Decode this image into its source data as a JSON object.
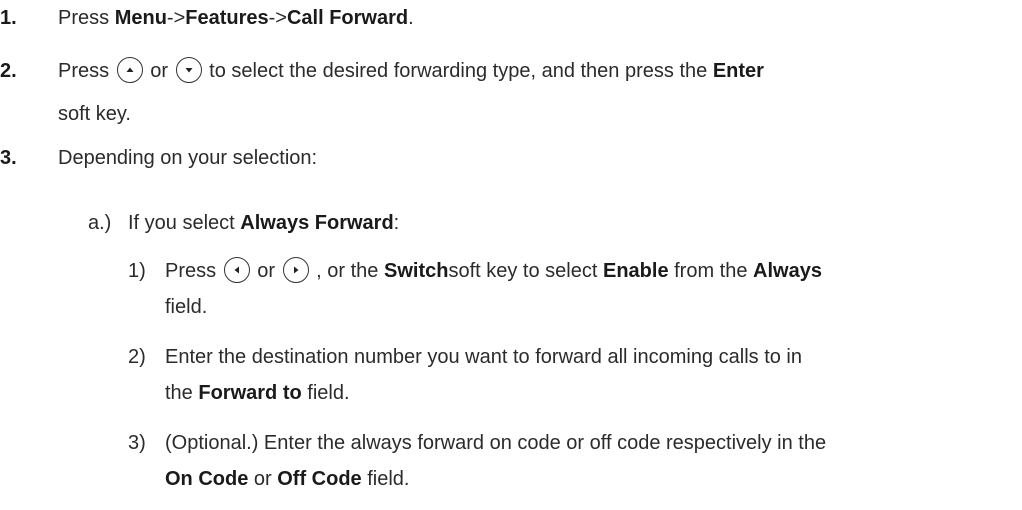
{
  "steps": [
    {
      "number": "1.",
      "text1": "Press ",
      "menu": "Menu",
      "sep1": "->",
      "features": "Features",
      "sep2": "->",
      "call_forward": "Call Forward",
      "end": "."
    },
    {
      "number": "2.",
      "text1": "Press",
      "or": "or",
      "text2": "to select the desired forwarding type, and then press the",
      "enter": "Enter",
      "text3": "soft key."
    },
    {
      "number": "3.",
      "text": "Depending on your selection:"
    }
  ],
  "substep_a": {
    "label": "a.)",
    "text1": "If you select ",
    "always_forward": "Always Forward",
    "end": ":"
  },
  "items": [
    {
      "label": "1)",
      "text1": "Press",
      "or": "or",
      "text2": ", or the",
      "switch": "Switch",
      "text3": "soft key to select",
      "enable": "Enable",
      "text4": "from the",
      "always": "Always",
      "text5": "field."
    },
    {
      "label": "2)",
      "text1": "Enter the destination number you want to forward all incoming calls to in",
      "text2": "the ",
      "forward_to": "Forward to",
      "text3": " field."
    },
    {
      "label": "3)",
      "text1": "(Optional.) Enter the always forward on code or off code respectively in the",
      "on_code": "On Code",
      "text2": " or ",
      "off_code": "Off Code",
      "text3": " field."
    }
  ],
  "icons": {
    "up": "up-arrow-key-icon",
    "down": "down-arrow-key-icon",
    "left": "left-arrow-key-icon",
    "right": "right-arrow-key-icon"
  }
}
